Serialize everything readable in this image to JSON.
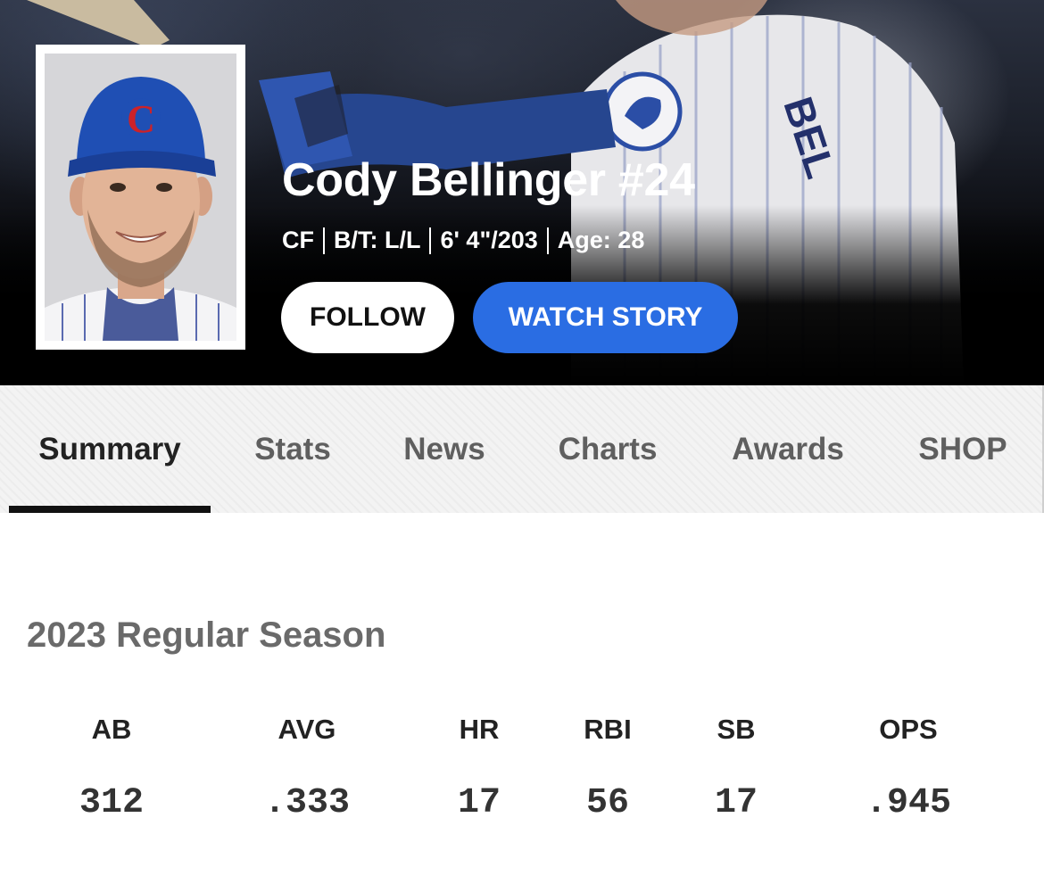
{
  "player": {
    "name": "Cody Bellinger #24",
    "position": "CF",
    "bats_throws": "B/T: L/L",
    "height_weight": "6' 4\"/203",
    "age": "Age: 28"
  },
  "actions": {
    "follow_label": "FOLLOW",
    "watch_story_label": "WATCH STORY"
  },
  "tabs": [
    {
      "label": "Summary",
      "active": true
    },
    {
      "label": "Stats"
    },
    {
      "label": "News"
    },
    {
      "label": "Charts"
    },
    {
      "label": "Awards"
    },
    {
      "label": "SHOP"
    }
  ],
  "season": {
    "title": "2023 Regular Season",
    "stats": [
      {
        "label": "AB",
        "value": "312"
      },
      {
        "label": "AVG",
        "value": ".333"
      },
      {
        "label": "HR",
        "value": "17"
      },
      {
        "label": "RBI",
        "value": "56"
      },
      {
        "label": "SB",
        "value": "17"
      },
      {
        "label": "OPS",
        "value": ".945"
      }
    ]
  },
  "colors": {
    "accent_blue": "#2a6de3",
    "cubs_blue": "#1f4fb4",
    "cubs_red": "#cc2229"
  }
}
